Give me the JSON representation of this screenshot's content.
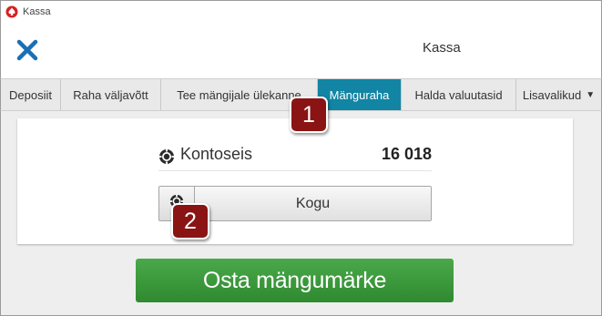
{
  "window": {
    "title": "Kassa",
    "icon": "poker-spade-icon"
  },
  "header": {
    "title": "Kassa",
    "close_icon": "close-icon"
  },
  "tabs": [
    {
      "label": "Deposiit",
      "active": false
    },
    {
      "label": "Raha väljavõtt",
      "active": false
    },
    {
      "label": "Tee mängijale ülekanne",
      "active": false
    },
    {
      "label": "Mänguraha",
      "active": true
    },
    {
      "label": "Halda valuutasid",
      "active": false
    },
    {
      "label": "Lisavalikud",
      "active": false,
      "dropdown": true
    }
  ],
  "balance": {
    "label": "Kontoseis",
    "value": "16 018",
    "icon": "chip-icon"
  },
  "collect": {
    "label": "Kogu",
    "icon": "chip-icon"
  },
  "buy": {
    "label": "Osta mängumärke"
  },
  "callouts": [
    "1",
    "2"
  ],
  "colors": {
    "accent": "#1185a3",
    "buy": "#3a9a3a",
    "close": "#1a6fb5",
    "badge": "#8a1414"
  }
}
